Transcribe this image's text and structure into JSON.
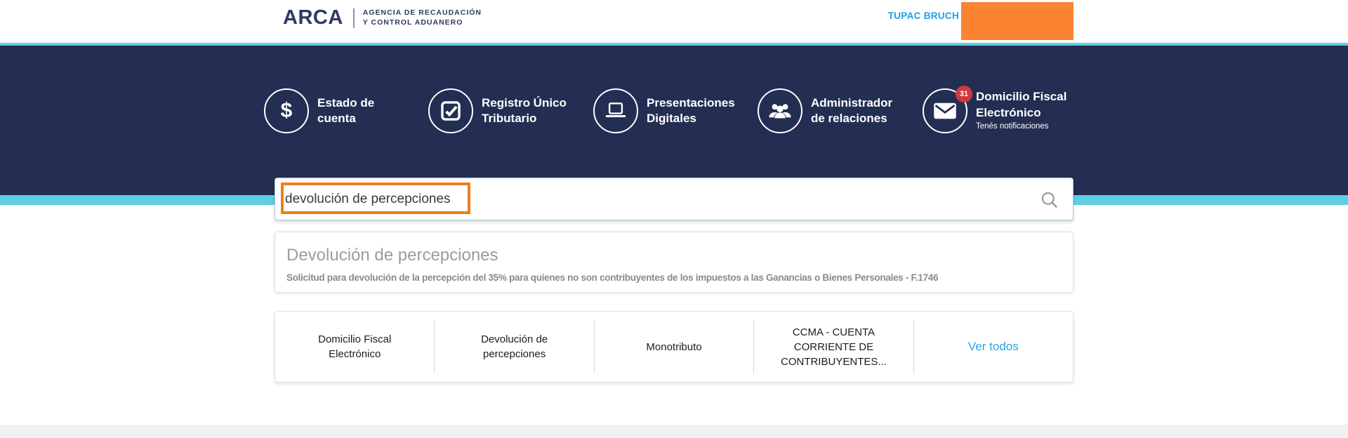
{
  "header": {
    "logo": {
      "brand": "ARCA",
      "tagline_line1": "AGENCIA DE RECAUDACIÓN",
      "tagline_line2": "Y CONTROL ADUANERO"
    },
    "user_name": "TUPAC BRUCH"
  },
  "nav": {
    "items": [
      {
        "icon": "dollar-icon",
        "label_line1": "Estado de",
        "label_line2": "cuenta"
      },
      {
        "icon": "checkbox-icon",
        "label_line1": "Registro Único",
        "label_line2": "Tributario"
      },
      {
        "icon": "laptop-icon",
        "label_line1": "Presentaciones",
        "label_line2": "Digitales"
      },
      {
        "icon": "group-icon",
        "label_line1": "Administrador",
        "label_line2": "de relaciones"
      },
      {
        "icon": "envelope-icon",
        "label_line1": "Domicilio Fiscal",
        "label_line2": "Electrónico",
        "badge": "31",
        "subtitle": "Tenés notificaciones"
      }
    ]
  },
  "search": {
    "value": "devolución de percepciones",
    "icon": "search-icon"
  },
  "result": {
    "title": "Devolución de percepciones",
    "description": "Solicitud para devolución de la percepción del 35% para quienes no son contribuyentes de los impuestos a las Ganancias o Bienes Personales - F.1746"
  },
  "quick_links": {
    "items": [
      "Domicilio Fiscal Electrónico",
      "Devolución de percepciones",
      "Monotributo",
      "CCMA - CUENTA CORRIENTE DE CONTRIBUYENTES..."
    ],
    "see_all": "Ver todos"
  },
  "colors": {
    "navy": "#242e52",
    "cyan": "#5ecfe2",
    "orange": "#fb8332",
    "annotation_orange": "#ee7e1b",
    "brand_navy": "#2e3a62",
    "link_blue": "#2aa4e5",
    "user_blue": "#1da1e8",
    "badge_red": "#cf3a3f",
    "footer_gray": "#f1f1f1"
  }
}
